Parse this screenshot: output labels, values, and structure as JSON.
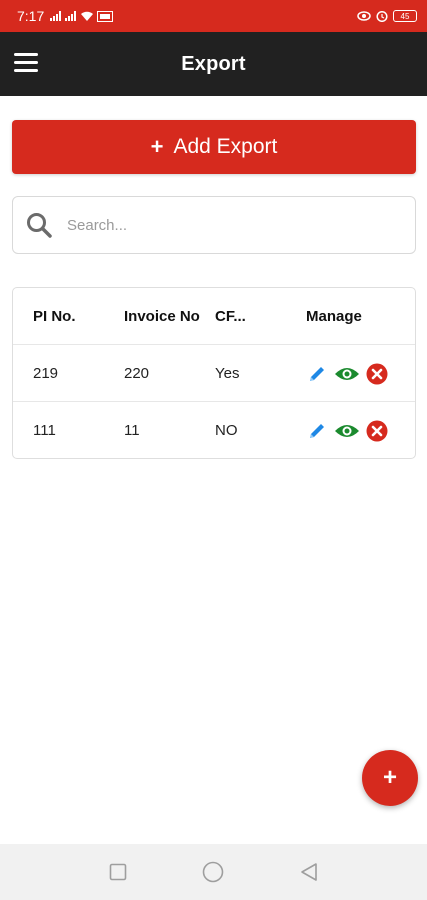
{
  "status_bar": {
    "time": "7:17",
    "battery": "45"
  },
  "app_bar": {
    "title": "Export"
  },
  "add_button": {
    "plus": "+",
    "label": "Add Export"
  },
  "search": {
    "placeholder": "Search..."
  },
  "table": {
    "headers": [
      "PI No.",
      "Invoice No",
      "CF...",
      "Manage"
    ],
    "rows": [
      {
        "pi_no": "219",
        "invoice_no": "220",
        "cf": "Yes"
      },
      {
        "pi_no": "111",
        "invoice_no": "11",
        "cf": "NO"
      }
    ]
  },
  "fab": {
    "label": "+"
  },
  "colors": {
    "primary": "#d62a1e",
    "app_bar": "#212121",
    "edit_icon": "#1e88e5",
    "view_icon": "#1b8a2e",
    "delete_icon": "#d62a1e"
  }
}
